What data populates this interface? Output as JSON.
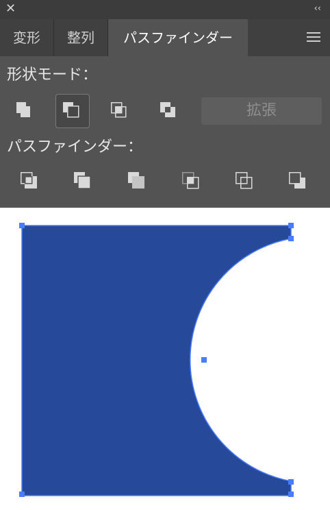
{
  "window": {
    "close_symbol": "✕",
    "collapse_symbol": "‹‹"
  },
  "tabs": [
    {
      "label": "変形",
      "active": false
    },
    {
      "label": "整列",
      "active": false
    },
    {
      "label": "パスファインダー",
      "active": true
    }
  ],
  "shape_modes": {
    "title": "形状モード：",
    "tools": [
      {
        "icon": "unite-icon",
        "selected": false
      },
      {
        "icon": "minus-front-icon",
        "selected": true
      },
      {
        "icon": "intersect-icon",
        "selected": false
      },
      {
        "icon": "exclude-icon",
        "selected": false
      }
    ],
    "expand_label": "拡張"
  },
  "pathfinders": {
    "title": "パスファインダー：",
    "tools": [
      {
        "icon": "divide-icon"
      },
      {
        "icon": "trim-icon"
      },
      {
        "icon": "merge-icon"
      },
      {
        "icon": "crop-icon"
      },
      {
        "icon": "outline-icon"
      },
      {
        "icon": "minus-back-icon"
      }
    ]
  },
  "colors": {
    "shape_fill": "#264a99",
    "selection": "#4a7cff",
    "panel_bg": "#535353"
  }
}
